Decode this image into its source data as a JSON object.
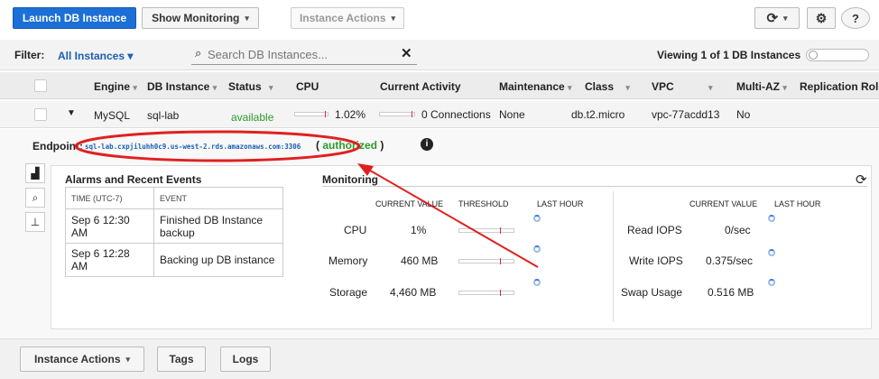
{
  "toolbar": {
    "launch": "Launch DB Instance",
    "monitoring": "Show Monitoring",
    "actions": "Instance Actions",
    "caret": "⌄"
  },
  "filter": {
    "label": "Filter:",
    "selected": "All Instances",
    "search_placeholder": "Search DB Instances...",
    "viewing": "Viewing 1 of 1 DB Instances"
  },
  "columns": [
    "Engine",
    "DB Instance",
    "Status",
    "CPU",
    "Current Activity",
    "Maintenance",
    "Class",
    "VPC",
    "Multi-AZ",
    "Replication Role"
  ],
  "row": {
    "engine": "MySQL",
    "instance": "sql-lab",
    "status": "available",
    "cpu": "1.02%",
    "activity": "0 Connections",
    "maintenance": "None",
    "class": "db.t2.micro",
    "vpc": "vpc-77acdd13",
    "multiaz": "No"
  },
  "endpoint": {
    "label": "Endpoint:",
    "value": "sql-lab.cxpjiluhh0c9.us-west-2.rds.amazonaws.com:3306",
    "status": "authorized"
  },
  "alarms": {
    "title": "Alarms and Recent Events",
    "col_time": "TIME (UTC-7)",
    "col_event": "EVENT",
    "rows": [
      {
        "time": "Sep 6 12:30 AM",
        "event": "Finished DB Instance backup"
      },
      {
        "time": "Sep 6 12:28 AM",
        "event": "Backing up DB instance"
      }
    ]
  },
  "monitoring": {
    "title": "Monitoring",
    "h_current": "CURRENT VALUE",
    "h_threshold": "THRESHOLD",
    "h_last": "LAST HOUR",
    "left": [
      {
        "name": "CPU",
        "value": "1%"
      },
      {
        "name": "Memory",
        "value": "460 MB"
      },
      {
        "name": "Storage",
        "value": "4,460 MB"
      }
    ],
    "right": [
      {
        "name": "Read IOPS",
        "value": "0/sec"
      },
      {
        "name": "Write IOPS",
        "value": "0.375/sec"
      },
      {
        "name": "Swap Usage",
        "value": "0.516 MB"
      }
    ]
  },
  "bottom": {
    "actions": "Instance Actions",
    "tags": "Tags",
    "logs": "Logs"
  },
  "colors": {
    "primary": "#1c6fd6",
    "available": "#2c9a2c",
    "annotation": "#e02020",
    "link": "#1a5fb4"
  }
}
